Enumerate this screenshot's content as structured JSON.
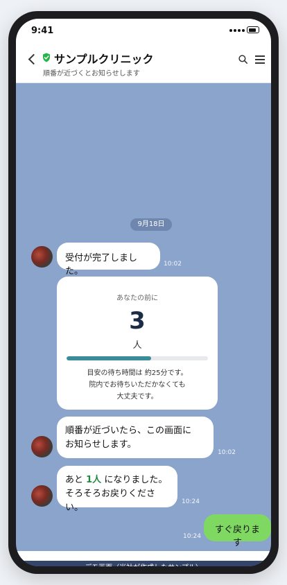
{
  "status_bar": {
    "time": "9:41"
  },
  "header": {
    "title": "サンプルクリニック",
    "subtitle": "順番が近づくとお知らせします",
    "icons": [
      "back-icon",
      "shield-icon",
      "search-icon",
      "menu-icon"
    ]
  },
  "chat": {
    "date_label": "9月18日",
    "messages": [
      {
        "sender": "clinic",
        "text": "受付が完了しました。",
        "time": "10:02"
      },
      {
        "sender": "clinic",
        "lines": [
          "順番が近づいたら、この画面に",
          "お知らせします。"
        ],
        "time": "10:02"
      },
      {
        "sender": "clinic",
        "parts": {
          "prefix": "あと ",
          "highlight": "1人",
          "suffix": " になりました。",
          "line2": "そろそろお戻りください。"
        },
        "time": "10:24"
      },
      {
        "sender": "user",
        "text": "すぐ戻ります",
        "time": "10:24"
      }
    ]
  },
  "queue_card": {
    "label": "あなたの前に",
    "count": "3",
    "unit": "人",
    "progress_fraction": 0.6,
    "lines": [
      "目安の待ち時間は 約25分です。",
      "院内でお待ちいただかなくても",
      "大丈夫です。"
    ]
  },
  "footer": {
    "text": "デモ画面（当社が作成したサンプル）"
  },
  "colors": {
    "chat_background": "#8aa4cc",
    "user_bubble": "#7fd861",
    "highlight_text": "#1f8a3c",
    "progress_fill": "#3a8c98",
    "footer_background": "#33456a"
  }
}
